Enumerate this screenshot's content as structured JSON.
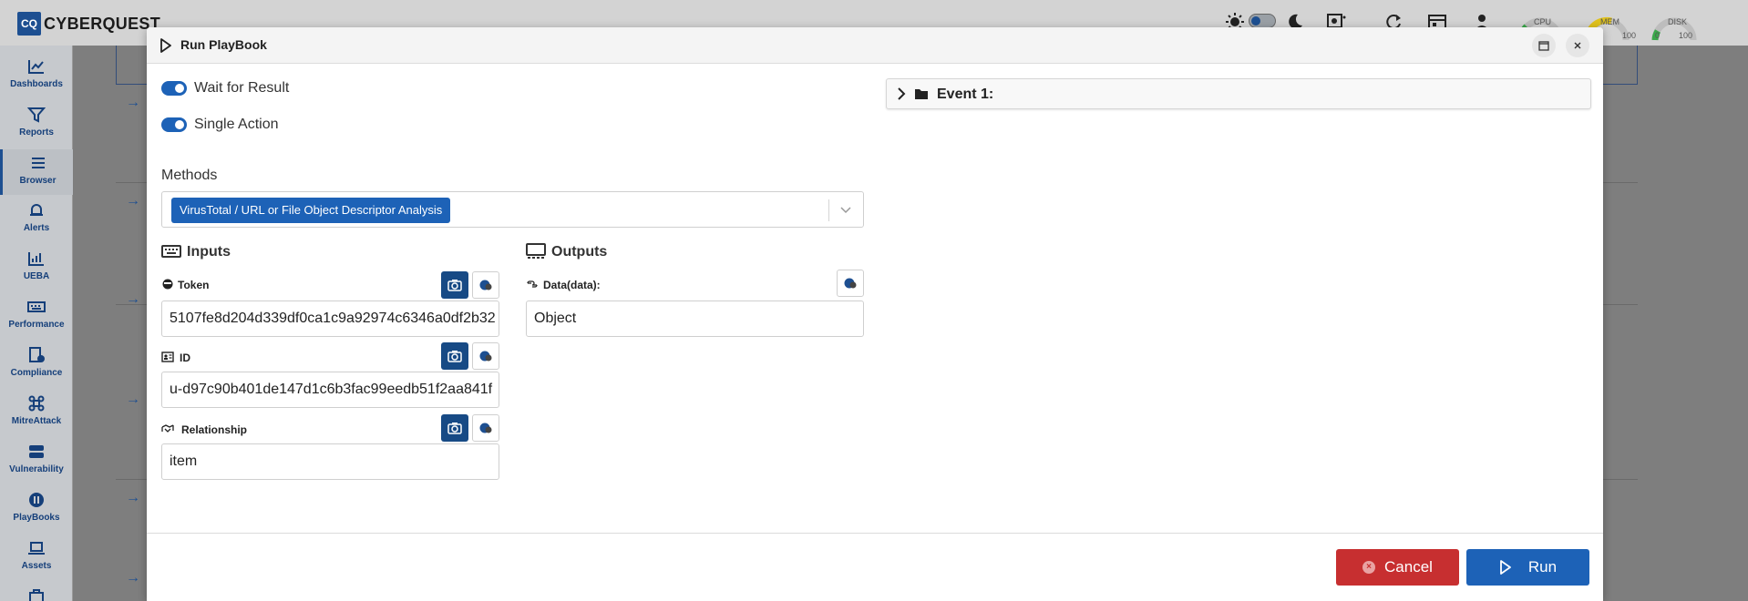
{
  "app": {
    "logo_badge": "CQ",
    "logo_text": "CYBERQUEST",
    "gauges": [
      {
        "label": "CPU"
      },
      {
        "label": "MEM",
        "max": "100"
      },
      {
        "label": "DISK",
        "min": "0",
        "max": "100"
      }
    ]
  },
  "sidebar": {
    "items": [
      {
        "label": "Dashboards",
        "icon": "chart-icon"
      },
      {
        "label": "Reports",
        "icon": "filter-icon"
      },
      {
        "label": "Browser",
        "icon": "list-icon",
        "active": true
      },
      {
        "label": "Alerts",
        "icon": "bell-icon"
      },
      {
        "label": "UEBA",
        "icon": "graph-icon"
      },
      {
        "label": "Performance",
        "icon": "keyboard-icon"
      },
      {
        "label": "Compliance",
        "icon": "doc-check-icon"
      },
      {
        "label": "MitreAttack",
        "icon": "command-icon"
      },
      {
        "label": "Vulnerability",
        "icon": "server-icon"
      },
      {
        "label": "PlayBooks",
        "icon": "playbook-icon"
      },
      {
        "label": "Assets",
        "icon": "laptop-icon"
      }
    ]
  },
  "modal": {
    "title": "Run PlayBook",
    "toggles": [
      {
        "label": "Wait for Result",
        "on": true
      },
      {
        "label": "Single Action",
        "on": true
      }
    ],
    "methods": {
      "label": "Methods",
      "selected": "VirusTotal / URL or File Object Descriptor Analysis"
    },
    "inputs": {
      "title": "Inputs",
      "fields": [
        {
          "label": "Token",
          "value": "5107fe8d204d339df0ca1c9a92974c6346a0df2b32"
        },
        {
          "label": "ID",
          "value": "u-d97c90b401de147d1c6b3fac99eedb51f2aa841f"
        },
        {
          "label": "Relationship",
          "value": "item"
        }
      ]
    },
    "outputs": {
      "title": "Outputs",
      "fields": [
        {
          "label": "Data(data):",
          "value": "Object"
        }
      ]
    },
    "event": {
      "label": "Event 1:"
    },
    "buttons": {
      "cancel": "Cancel",
      "run": "Run"
    }
  },
  "colors": {
    "primary": "#1d62b7",
    "dark_primary": "#174a85",
    "danger": "#c72f30",
    "sidebar_text": "#153f7a"
  }
}
